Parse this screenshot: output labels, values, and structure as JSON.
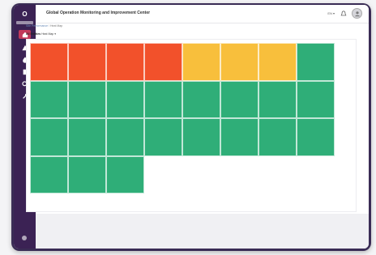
{
  "app": {
    "logo_text": "O"
  },
  "topbar": {
    "title": "Global Operation Monitoring and Improvement Center",
    "lang_label": "EN ▾",
    "icons": [
      "language-icon",
      "bell-icon",
      "user-avatar"
    ]
  },
  "sidebar": {
    "items": [
      {
        "name": "home",
        "icon": "home-icon",
        "active": true
      },
      {
        "name": "alerts",
        "icon": "warning-icon",
        "active": false
      },
      {
        "name": "incidents",
        "icon": "flame-icon",
        "active": false
      },
      {
        "name": "reports",
        "icon": "document-icon",
        "active": false
      },
      {
        "name": "search",
        "icon": "search-icon",
        "active": false
      },
      {
        "name": "tools",
        "icon": "wrench-icon",
        "active": false
      }
    ]
  },
  "breadcrumb": {
    "parent": "Site Performance",
    "current": "Heat Map"
  },
  "subhead": {
    "label": "All Entities",
    "value": "Heat Map ▾"
  },
  "heatmap": {
    "colors": {
      "red": "#f2512b",
      "yellow": "#f8bf3c",
      "green": "#2fae78"
    },
    "columns": 8,
    "cells": [
      "red",
      "red",
      "red",
      "red",
      "yellow",
      "yellow",
      "yellow",
      "green",
      "green",
      "green",
      "green",
      "green",
      "green",
      "green",
      "green",
      "green",
      "green",
      "green",
      "green",
      "green",
      "green",
      "green",
      "green",
      "green",
      "green",
      "green",
      "green"
    ]
  }
}
